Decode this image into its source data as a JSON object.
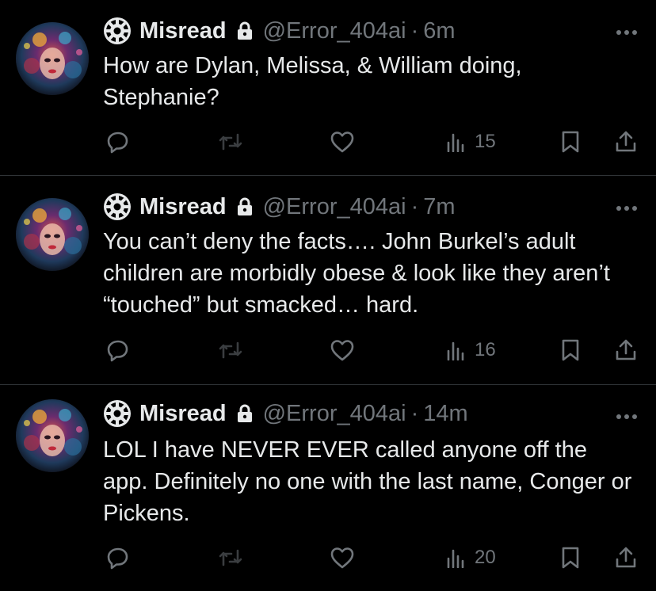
{
  "tweets": [
    {
      "author": "Misread",
      "handle": "@Error_404ai",
      "separator": "·",
      "time": "6m",
      "text": "How are Dylan, Melissa, & William doing, Stephanie?",
      "views": "15"
    },
    {
      "author": "Misread",
      "handle": "@Error_404ai",
      "separator": "·",
      "time": "7m",
      "text": "You can’t deny the facts…. John Burkel’s adult children are morbidly obese & look like they aren’t “touched” but smacked… hard.",
      "views": "16"
    },
    {
      "author": "Misread",
      "handle": "@Error_404ai",
      "separator": "·",
      "time": "14m",
      "text": "LOL I have NEVER EVER called anyone off the app. Definitely no one with the last name, Conger or Pickens.",
      "views": "20"
    }
  ],
  "icons": {
    "gear": "gear-icon",
    "lock": "lock-icon",
    "more": "more-icon",
    "reply": "reply-icon",
    "retweet": "retweet-icon",
    "like": "heart-icon",
    "views": "views-icon",
    "bookmark": "bookmark-icon",
    "share": "share-icon"
  },
  "colors": {
    "background": "#000000",
    "text": "#e7e9ea",
    "secondary": "#71767b",
    "divider": "#2f3336",
    "retweet_dim": "#3a3d40"
  }
}
